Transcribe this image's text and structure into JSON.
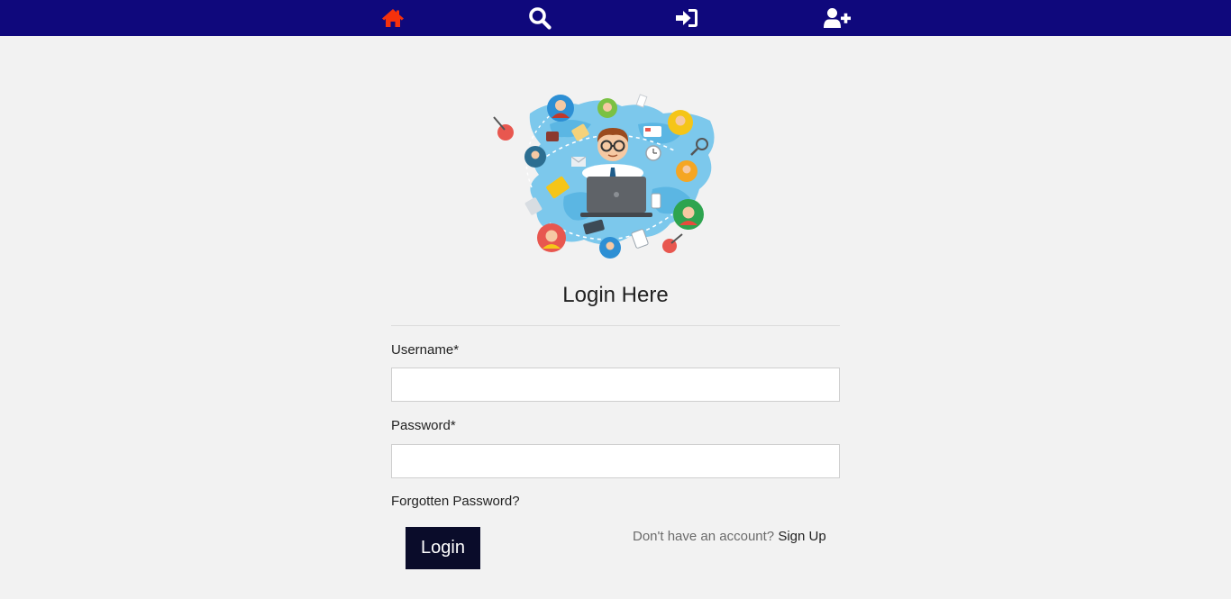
{
  "nav": {
    "items": [
      {
        "icon": "home-icon",
        "color": "#f5310c"
      },
      {
        "icon": "search-icon",
        "color": "#ffffff"
      },
      {
        "icon": "sign-in-icon",
        "color": "#ffffff"
      },
      {
        "icon": "user-plus-icon",
        "color": "#ffffff"
      }
    ],
    "background": "#0f087c"
  },
  "hero": {
    "icon": "networking-illustration"
  },
  "login": {
    "title": "Login Here",
    "username_label": "Username*",
    "username_value": "",
    "password_label": "Password*",
    "password_value": "",
    "forgot_label": "Forgotten Password?",
    "button_label": "Login",
    "signup_prompt": "Don't have an account?",
    "signup_link": "Sign Up"
  },
  "colors": {
    "page_background": "#f2f2f2",
    "button_background": "#0a0c2a"
  }
}
